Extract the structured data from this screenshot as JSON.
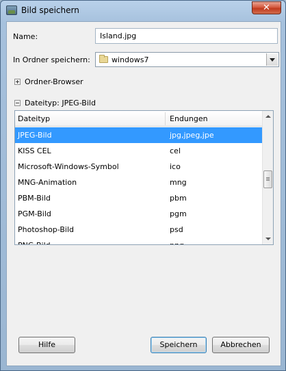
{
  "window": {
    "title": "Bild speichern",
    "close_label": "✕"
  },
  "form": {
    "name_label": "Name:",
    "name_value": "Island.jpg",
    "folder_label": "In Ordner speichern:",
    "folder_value": "windows7"
  },
  "expanders": {
    "browser_label": "Ordner-Browser",
    "filetype_label": "Dateityp: JPEG-Bild"
  },
  "filetype_list": {
    "columns": [
      "Dateityp",
      "Endungen"
    ],
    "rows": [
      {
        "type": "JPEG-Bild",
        "ext": "jpg,jpeg,jpe",
        "selected": true
      },
      {
        "type": "KISS CEL",
        "ext": "cel"
      },
      {
        "type": "Microsoft-Windows-Symbol",
        "ext": "ico"
      },
      {
        "type": "MNG-Animation",
        "ext": "mng"
      },
      {
        "type": "PBM-Bild",
        "ext": "pbm"
      },
      {
        "type": "PGM-Bild",
        "ext": "pgm"
      },
      {
        "type": "Photoshop-Bild",
        "ext": "psd"
      },
      {
        "type": "PNG-Bild",
        "ext": "png"
      }
    ]
  },
  "buttons": {
    "help": "Hilfe",
    "save": "Speichern",
    "cancel": "Abbrechen"
  },
  "colors": {
    "selection": "#3399ff",
    "close": "#c03a1e"
  }
}
